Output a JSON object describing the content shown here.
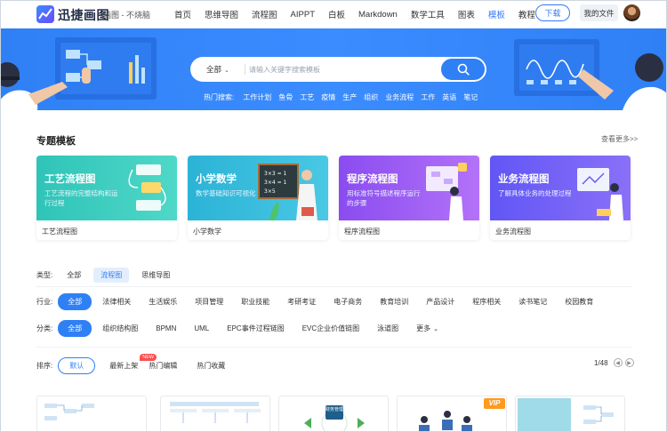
{
  "header": {
    "brand": "迅捷画图",
    "subtitle": "脑图 - 不烧脑",
    "nav": [
      "首页",
      "思维导图",
      "流程图",
      "AIPPT",
      "白板",
      "Markdown",
      "数学工具",
      "图表",
      "模板",
      "教程"
    ],
    "active_nav": "模板",
    "download_label": "下载",
    "my_files_label": "我的文件"
  },
  "search": {
    "scope": "全部",
    "placeholder": "请输入关键字搜索模板",
    "value": ""
  },
  "hot_search": {
    "label": "热门搜索:",
    "items": [
      "工作计划",
      "鱼骨",
      "工艺",
      "疫情",
      "生产",
      "组织",
      "业务流程",
      "工作",
      "英语",
      "笔记"
    ]
  },
  "special": {
    "title": "专题模板",
    "see_more": "查看更多>>",
    "cards": [
      {
        "title": "工艺流程图",
        "desc": "工艺流程的完整结构和运行过程",
        "label": "工艺流程图",
        "color_from": "#2fc4b8",
        "color_to": "#4ad6c7"
      },
      {
        "title": "小学数学",
        "desc": "数学基础知识可视化",
        "label": "小学数学",
        "color_from": "#2bb3d6",
        "color_to": "#48c6e3"
      },
      {
        "title": "程序流程图",
        "desc": "用标准符号描述程序运行的步骤",
        "label": "程序流程图",
        "color_from": "#8a4cf0",
        "color_to": "#b06cf7"
      },
      {
        "title": "业务流程图",
        "desc": "了解具体业务的处理过程",
        "label": "业务流程图",
        "color_from": "#6156f5",
        "color_to": "#8a6ef8"
      }
    ]
  },
  "filters": {
    "type": {
      "label": "类型:",
      "options": [
        "全部",
        "流程图",
        "思维导图"
      ],
      "selected": "流程图"
    },
    "industry": {
      "label": "行业:",
      "options": [
        "全部",
        "法律相关",
        "生活娱乐",
        "项目管理",
        "职业技能",
        "考研考证",
        "电子商务",
        "教育培训",
        "产品设计",
        "程序相关",
        "读书笔记",
        "校园教育"
      ],
      "selected": "全部"
    },
    "category": {
      "label": "分类:",
      "options": [
        "全部",
        "组织结构图",
        "BPMN",
        "UML",
        "EPC事件过程链图",
        "EVC企业价值链图",
        "泳道图",
        "更多"
      ],
      "selected": "全部"
    }
  },
  "sort": {
    "label": "排序:",
    "options": [
      "默认",
      "最新上架",
      "热门编辑",
      "热门收藏"
    ],
    "selected": "默认",
    "new_badge": "NEW",
    "page": "1/48"
  },
  "thumb_labels": {
    "finance": "财务管理",
    "vip": "VIP"
  },
  "colors": {
    "accent": "#2f80f5",
    "banner": "#3b8cff"
  }
}
